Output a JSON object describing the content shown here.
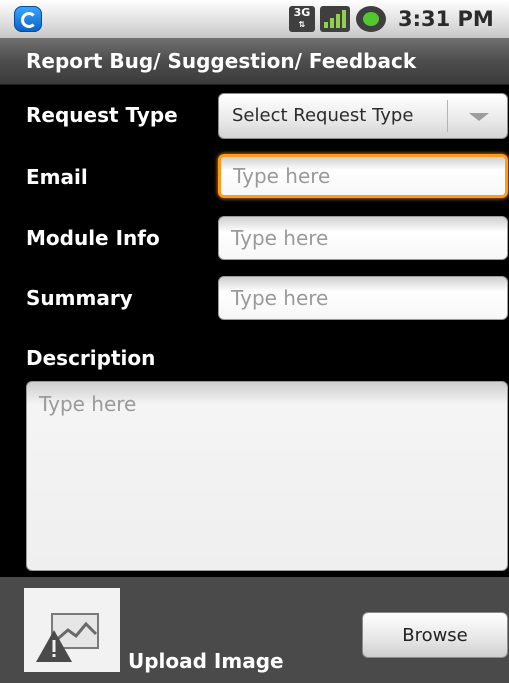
{
  "status_bar": {
    "network": "3G",
    "time": "3:31 PM"
  },
  "title": "Report Bug/ Suggestion/ Feedback",
  "form": {
    "request_type": {
      "label": "Request Type",
      "selected": "Select Request Type"
    },
    "email": {
      "label": "Email",
      "value": "",
      "placeholder": "Type here"
    },
    "module_info": {
      "label": "Module Info",
      "value": "",
      "placeholder": "Type here"
    },
    "summary": {
      "label": "Summary",
      "value": "",
      "placeholder": "Type here"
    },
    "description": {
      "label": "Description",
      "value": "",
      "placeholder": "Type here"
    }
  },
  "upload": {
    "label": "Upload Image",
    "browse_label": "Browse",
    "thumbnail_icon": "broken-image-icon"
  },
  "colors": {
    "focus": "#ff9a1a",
    "background": "#000000"
  }
}
